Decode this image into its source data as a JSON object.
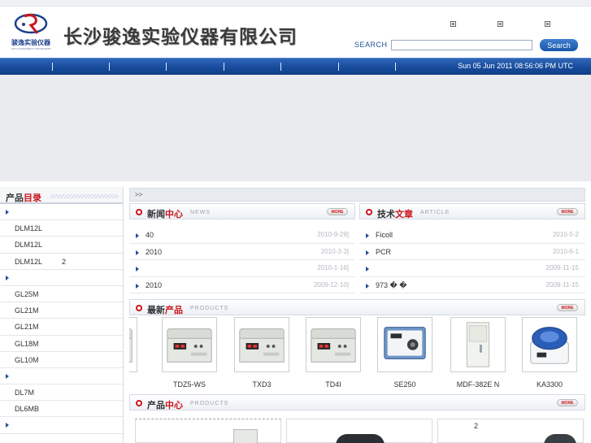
{
  "header": {
    "logo_text": "骏逸实验仪器",
    "logo_subtext": "JUNYI EXPERIMENT INSTRUMENT",
    "company_name": "长沙骏逸实验仪器有限公司",
    "search_label": "SEARCH",
    "search_value": "",
    "search_button": "Search"
  },
  "nav": {
    "datetime": "Sun 05 Jun 2011 08:56:06 PM UTC"
  },
  "sidebar": {
    "title_plain": "产品",
    "title_accent": "目录",
    "items": [
      {
        "type": "group",
        "label": ""
      },
      {
        "type": "item",
        "label": "DLM12L",
        "note": ""
      },
      {
        "type": "item",
        "label": "DLM12L",
        "note": ""
      },
      {
        "type": "item",
        "label": "DLM12L",
        "note": "2"
      },
      {
        "type": "group",
        "label": ""
      },
      {
        "type": "item",
        "label": "GL25M",
        "note": ""
      },
      {
        "type": "item",
        "label": "GL21M",
        "note": ""
      },
      {
        "type": "item",
        "label": "GL21M",
        "note": ""
      },
      {
        "type": "item",
        "label": "GL18M",
        "note": ""
      },
      {
        "type": "item",
        "label": "GL10M",
        "note": ""
      },
      {
        "type": "group",
        "label": ""
      },
      {
        "type": "item",
        "label": "DL7M",
        "note": ""
      },
      {
        "type": "item",
        "label": "DL6MB",
        "note": ""
      },
      {
        "type": "group",
        "label": ""
      }
    ]
  },
  "breadcrumb": ">>",
  "news": {
    "title_plain": "新闻",
    "title_accent": "中心",
    "subtitle": "NEWS",
    "more": "MORE",
    "items": [
      {
        "text": "40",
        "date": "2010-9-29]"
      },
      {
        "text": "2010",
        "date": "2010-3-3]"
      },
      {
        "text": "",
        "date": "2010-1-16]"
      },
      {
        "text": "2010",
        "date": "2009-12-10]"
      }
    ]
  },
  "articles": {
    "title_plain": "技术",
    "title_accent": "文章",
    "subtitle": "ARTICLE",
    "more": "MORE",
    "items": [
      {
        "text": "Ficoll",
        "date": "2010-5-2"
      },
      {
        "text": "PCR",
        "date": "2010-6-1"
      },
      {
        "text": "",
        "date": "2009-11-15"
      },
      {
        "text": "973 � �",
        "date": "2009-11-15"
      }
    ]
  },
  "latest": {
    "title_plain": "最新",
    "title_accent": "产品",
    "subtitle": "PRODUCTS",
    "more": "MORE",
    "products": [
      {
        "name": "",
        "icon": "centrifuge-icon"
      },
      {
        "name": "TDZ5-WS",
        "icon": "centrifuge-icon"
      },
      {
        "name": "TXD3",
        "icon": "centrifuge-icon"
      },
      {
        "name": "TD4I",
        "icon": "centrifuge-icon"
      },
      {
        "name": "SE250",
        "icon": "mixer-icon"
      },
      {
        "name": "MDF-382E N",
        "icon": "freezer-icon"
      },
      {
        "name": "KA3300",
        "icon": "centrifuge-icon"
      }
    ]
  },
  "products_center": {
    "title_plain": "产品",
    "title_accent": "中心",
    "subtitle": "PRODUCTS",
    "more": "MORE",
    "box_note": "2"
  },
  "colors": {
    "nav_blue": "#164a9a",
    "accent_red": "#c8161e",
    "link_blue": "#1f4f96"
  }
}
